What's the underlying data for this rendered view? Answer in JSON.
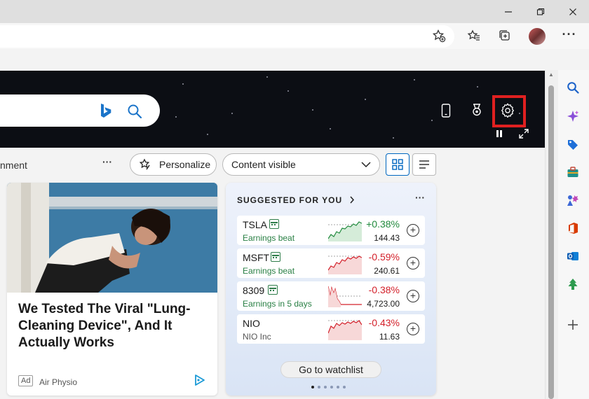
{
  "window": {
    "minimize_icon": "minimize-icon",
    "restore_icon": "restore-icon",
    "close_icon": "close-icon"
  },
  "toolbar": {
    "icons": [
      "favorite-add-icon",
      "favorites-icon",
      "collections-icon",
      "profile-avatar",
      "more-icon"
    ],
    "more_label": "···"
  },
  "hero": {
    "search_placeholder": "",
    "icons": [
      "phone-icon",
      "rewards-icon",
      "settings-icon",
      "pause-icon",
      "expand-icon"
    ]
  },
  "nav": {
    "partial_tab": "nment",
    "more": "···",
    "personalize_label": "Personalize",
    "content_visible_label": "Content visible"
  },
  "article": {
    "title": "We Tested The Viral \"Lung-Cleaning Device\", And It Actually Works",
    "ad_label": "Ad",
    "source": "Air Physio"
  },
  "watchlist": {
    "header": "SUGGESTED FOR YOU",
    "more": "···",
    "stocks": [
      {
        "ticker": "TSLA",
        "sub": "Earnings beat",
        "change": "+0.38%",
        "price": "144.43",
        "direction": "up"
      },
      {
        "ticker": "MSFT",
        "sub": "Earnings beat",
        "change": "-0.59%",
        "price": "240.61",
        "direction": "down"
      },
      {
        "ticker": "8309",
        "sub": "Earnings in 5 days",
        "change": "-0.38%",
        "price": "4,723.00",
        "direction": "down"
      },
      {
        "ticker": "NIO",
        "sub": "NIO Inc",
        "change": "-0.43%",
        "price": "11.63",
        "direction": "down"
      }
    ],
    "button_label": "Go to watchlist"
  },
  "colors": {
    "accent": "#0067c0",
    "up": "#218a3d",
    "down": "#d3202a",
    "highlight": "#e02020"
  },
  "sidebar": {
    "icons": [
      "search-icon",
      "copilot-icon",
      "shopping-icon",
      "tools-icon",
      "games-icon",
      "office-icon",
      "outlook-icon",
      "drop-icon",
      "add-icon"
    ]
  }
}
